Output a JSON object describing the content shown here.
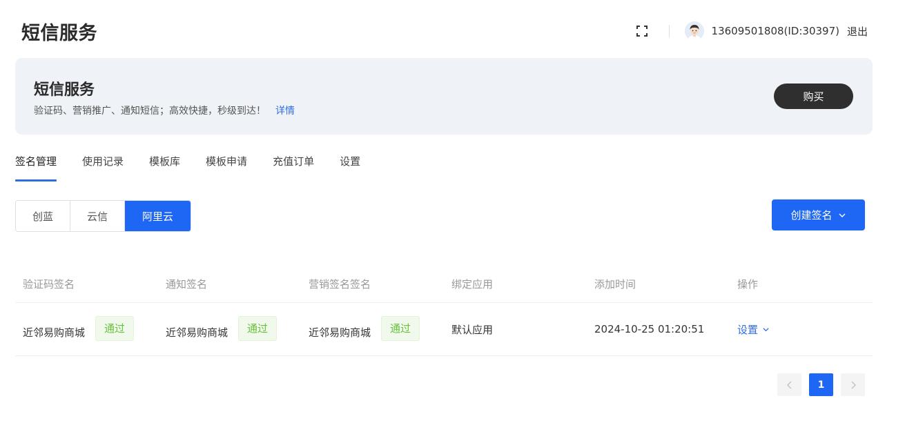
{
  "header": {
    "title": "短信服务",
    "user_info": "13609501808(ID:30397)",
    "logout_label": "退出"
  },
  "banner": {
    "title": "短信服务",
    "description": "验证码、营销推广、通知短信；高效快捷，秒级到达！",
    "detail_link": "详情",
    "buy_label": "购买"
  },
  "tabs": [
    {
      "label": "签名管理",
      "active": true
    },
    {
      "label": "使用记录"
    },
    {
      "label": "模板库"
    },
    {
      "label": "模板申请"
    },
    {
      "label": "充值订单"
    },
    {
      "label": "设置"
    }
  ],
  "providers": [
    {
      "label": "创蓝"
    },
    {
      "label": "云信"
    },
    {
      "label": "阿里云",
      "active": true
    }
  ],
  "create_label": "创建签名",
  "table": {
    "columns": [
      "验证码签名",
      "通知签名",
      "营销签名签名",
      "绑定应用",
      "添加时间",
      "操作"
    ],
    "rows": [
      {
        "verify_sign": "近邻易购商城",
        "verify_status": "通过",
        "notify_sign": "近邻易购商城",
        "notify_status": "通过",
        "marketing_sign": "近邻易购商城",
        "marketing_status": "通过",
        "app": "默认应用",
        "added_time": "2024-10-25 01:20:51",
        "action_label": "设置"
      }
    ]
  },
  "pagination": {
    "current_page": "1"
  },
  "colors": {
    "primary": "#1e67f5",
    "link": "#2f6ee0",
    "success": "#67c23a",
    "dark_button": "#2f2f2f",
    "banner_bg": "#eff2f7"
  }
}
